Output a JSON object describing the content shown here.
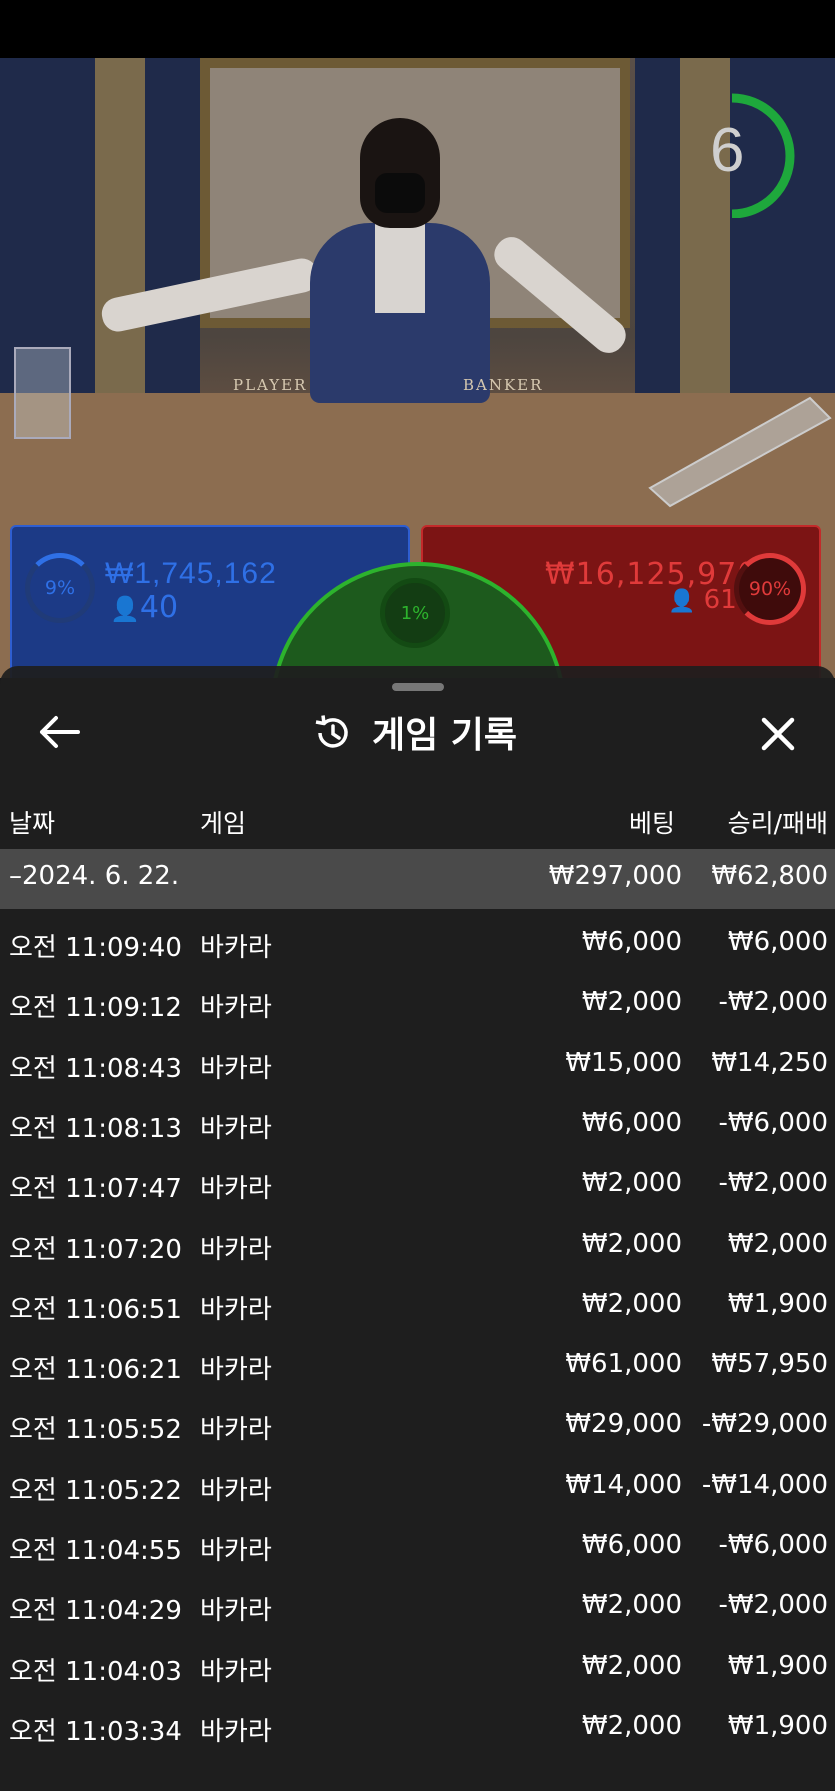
{
  "live": {
    "timer": "6",
    "felt_player": "PLAYER",
    "felt_banker": "BANKER",
    "player": {
      "pct": "9%",
      "amount": "₩1,745,162",
      "count": "40"
    },
    "tie": {
      "pct": "1%"
    },
    "banker": {
      "pct": "90%",
      "amount": "₩16,125,970",
      "count": "61"
    },
    "colors": {
      "player": "#2f70e6",
      "banker": "#e03a3a",
      "tie": "#2db32d"
    }
  },
  "history": {
    "title": "게임 기록",
    "icons": {
      "back": "arrow-left-icon",
      "history": "history-icon",
      "close": "close-icon"
    },
    "columns": {
      "date": "날짜",
      "game": "게임",
      "bet": "베팅",
      "result": "승리/패배"
    },
    "summary": {
      "date": "–2024. 6. 22.",
      "bet": "₩297,000",
      "result": "₩62,800"
    },
    "rows": [
      {
        "time": "오전 11:09:40",
        "game": "바카라",
        "bet": "₩6,000",
        "result": "₩6,000"
      },
      {
        "time": "오전 11:09:12",
        "game": "바카라",
        "bet": "₩2,000",
        "result": "-₩2,000"
      },
      {
        "time": "오전 11:08:43",
        "game": "바카라",
        "bet": "₩15,000",
        "result": "₩14,250"
      },
      {
        "time": "오전 11:08:13",
        "game": "바카라",
        "bet": "₩6,000",
        "result": "-₩6,000"
      },
      {
        "time": "오전 11:07:47",
        "game": "바카라",
        "bet": "₩2,000",
        "result": "-₩2,000"
      },
      {
        "time": "오전 11:07:20",
        "game": "바카라",
        "bet": "₩2,000",
        "result": "₩2,000"
      },
      {
        "time": "오전 11:06:51",
        "game": "바카라",
        "bet": "₩2,000",
        "result": "₩1,900"
      },
      {
        "time": "오전 11:06:21",
        "game": "바카라",
        "bet": "₩61,000",
        "result": "₩57,950"
      },
      {
        "time": "오전 11:05:52",
        "game": "바카라",
        "bet": "₩29,000",
        "result": "-₩29,000"
      },
      {
        "time": "오전 11:05:22",
        "game": "바카라",
        "bet": "₩14,000",
        "result": "-₩14,000"
      },
      {
        "time": "오전 11:04:55",
        "game": "바카라",
        "bet": "₩6,000",
        "result": "-₩6,000"
      },
      {
        "time": "오전 11:04:29",
        "game": "바카라",
        "bet": "₩2,000",
        "result": "-₩2,000"
      },
      {
        "time": "오전 11:04:03",
        "game": "바카라",
        "bet": "₩2,000",
        "result": "₩1,900"
      },
      {
        "time": "오전 11:03:34",
        "game": "바카라",
        "bet": "₩2,000",
        "result": "₩1,900"
      }
    ]
  }
}
